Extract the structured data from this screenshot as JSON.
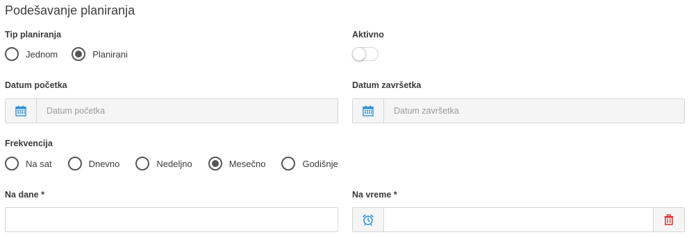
{
  "title": "Podešavanje planiranja",
  "tip_planiranja": {
    "label": "Tip planiranja",
    "options": [
      {
        "label": "Jednom",
        "checked": false
      },
      {
        "label": "Planirani",
        "checked": true
      }
    ]
  },
  "aktivno": {
    "label": "Aktivno",
    "value": false
  },
  "datum_pocetka": {
    "label": "Datum početka",
    "placeholder": "Datum početka",
    "icon": "calendar-icon"
  },
  "datum_zavrsetka": {
    "label": "Datum završetka",
    "placeholder": "Datum završetka",
    "icon": "calendar-icon"
  },
  "frekvencija": {
    "label": "Frekvencija",
    "options": [
      {
        "label": "Na sat",
        "checked": false
      },
      {
        "label": "Dnevno",
        "checked": false
      },
      {
        "label": "Nedeljno",
        "checked": false
      },
      {
        "label": "Mesečno",
        "checked": true
      },
      {
        "label": "Godišnje",
        "checked": false
      }
    ]
  },
  "na_dane": {
    "label": "Na dane *",
    "value": ""
  },
  "na_vreme": {
    "label": "Na vreme *",
    "value": "",
    "icon": "alarm-clock-icon",
    "delete_icon": "trash-icon"
  },
  "colors": {
    "calendar_icon": "#2b8fd6",
    "delete_icon": "#d9302c",
    "radio_border": "#555555"
  }
}
